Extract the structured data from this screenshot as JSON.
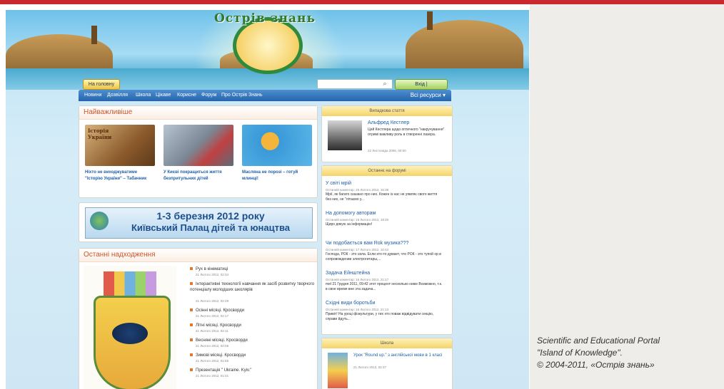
{
  "caption": {
    "line1": "Scientific and Educational Portal",
    "line2": "\"Island of Knowledge\".",
    "line3": "© 2004-2011, «Острів знань»"
  },
  "header": {
    "logo_text": "Острів знань",
    "home_button": "На головну",
    "search_placeholder": "",
    "login_button": "Вхід | Зареєструватися"
  },
  "nav": {
    "items": [
      "Новини",
      "Дозвілля",
      "Школа",
      "Цікаве",
      "Корисне",
      "Форум",
      "Про Острів Знань"
    ],
    "all_resources": "Всі ресурси"
  },
  "important": {
    "title": "Найважливіше",
    "cards": [
      {
        "img_text": "Історія України",
        "caption": "Ніхто не виходжуватиме \"Історію України\" – Табачник"
      },
      {
        "img_text": "",
        "caption": "У Києві покращиться життя безпритульних дітей"
      },
      {
        "img_text": "",
        "caption": "Масляна не порозі – готуй млинці!"
      }
    ]
  },
  "ad": {
    "line1": "1-3 березня 2012 року",
    "line2": "Київський Палац дітей та юнацтва"
  },
  "recent": {
    "title": "Останні надходження",
    "items": [
      {
        "text": "Рух в кінематиці",
        "date": "21 Лютого 2012, 02:34"
      },
      {
        "text": "Інтерактивні технології навчання як засіб розвитку творчого потенціалу молодших школярів",
        "date": "21 Лютого 2012, 02:29"
      },
      {
        "text": "Осінні місяці. Кросворди",
        "date": "21 Лютого 2012, 02:17"
      },
      {
        "text": "Літні місяці. Кросворди",
        "date": "21 Лютого 2012, 02:11"
      },
      {
        "text": "Весняні місяці. Кросворди",
        "date": "21 Лютого 2012, 02:05"
      },
      {
        "text": "Зимові місяці. Кросворди",
        "date": "21 Лютого 2012, 01:55"
      },
      {
        "text": "Презентація \" Ukraine. Kyiv.\"",
        "date": "21 Лютого 2012, 01:41"
      }
    ]
  },
  "featured": {
    "title": "Випадкова стаття",
    "name": "Альфред Кестлер",
    "text": "Цей Кестлера щодо оптичного \"накручування\" отримі важливу роль в створенні лазера.",
    "date": "22 Листопада 2006, 00:00"
  },
  "forum": {
    "title": "Останнє на форумі",
    "posts": [
      {
        "title": "У світі мрій",
        "meta": "Останній коментар: 25 Лютого 2012, 15:39",
        "text": "Мрії, як багато сказано про них. Кожен із нас не уявляє свого життя без них, не \"літаємо у..."
      },
      {
        "title": "На допомогу авторам",
        "meta": "Останній коментар: 19 Лютого 2012, 19:20",
        "text": "Щиро дякую за інформацію!"
      },
      {
        "title": "Чи подобається вам Rok музика???",
        "meta": "Останній коментар: 17 Лютого 2012, 10:44",
        "text": "Господа, РОК - это сила. Если кто-то думает, что РОК - это тупой ор в сопровождении электрогитары,..."
      },
      {
        "title": "Задача Ейнштейна",
        "meta": "Останній коментар: 16 Лютого 2012, 21:17",
        "text": "mel 21 Грудня 2011, 09:42 этот процент несколько ниже Возможно, т.к. в свое время вне эта задача..."
      },
      {
        "title": "Східні види боротьби",
        "meta": "Останній коментар: 16 Лютого 2012, 21:13",
        "text": "Привіт! На уроці фізкультури, у тих хто поваж відвідувати секцію, справи йдуть..."
      }
    ]
  },
  "school": {
    "title": "Школа",
    "item": "Урок \"Round up.\" з англійської мови в 1 класі",
    "date": "21 Лютого 2012, 02:37"
  }
}
